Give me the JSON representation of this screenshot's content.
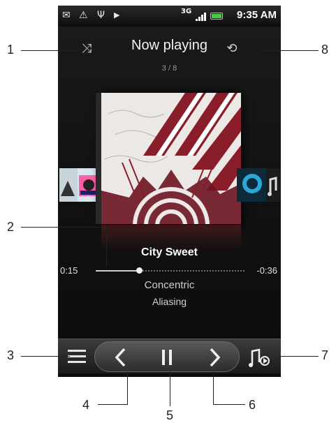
{
  "status_bar": {
    "network": "3G",
    "time": "9:35 AM",
    "icons": [
      "mail-icon",
      "warning-icon",
      "usb-icon",
      "play-status-icon",
      "signal-icon",
      "battery-icon"
    ]
  },
  "header": {
    "title": "Now playing",
    "track_position": "3 / 8",
    "shuffle_icon": "shuffle-icon",
    "repeat_icon": "repeat-icon"
  },
  "song": {
    "title": "City Sweet",
    "artist": "Concentric",
    "album": "Aliasing",
    "elapsed": "0:15",
    "remaining": "-0:36",
    "progress": 0.29
  },
  "controls": {
    "menu_icon": "menu-icon",
    "prev_icon": "previous-icon",
    "pause_icon": "pause-icon",
    "next_icon": "next-icon",
    "library_icon": "music-library-icon"
  },
  "callouts": [
    "1",
    "2",
    "3",
    "4",
    "5",
    "6",
    "7",
    "8"
  ],
  "colors": {
    "background": "#111111",
    "text": "#ffffff",
    "subtext": "#cfcfcf",
    "art_accent": "#8a1d2a"
  }
}
